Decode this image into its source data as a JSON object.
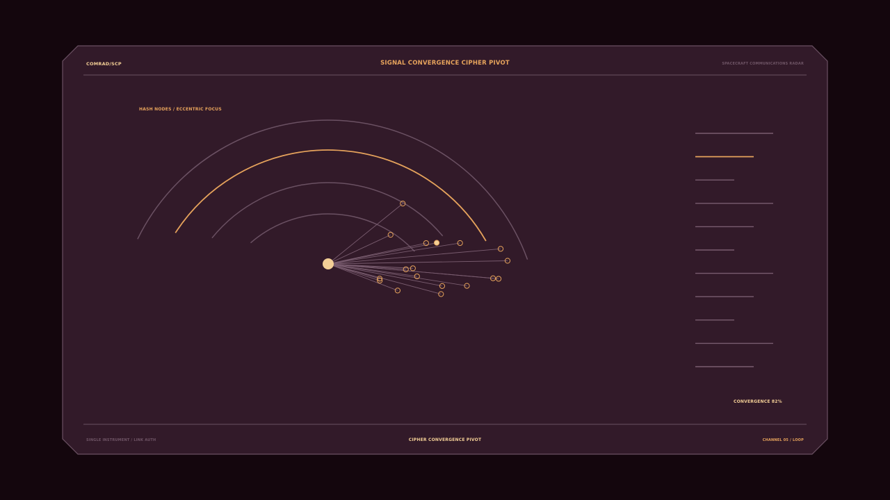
{
  "header": {
    "brand": "COMRAD/SCP",
    "title": "SIGNAL CONVERGENCE CIPHER PIVOT",
    "subtitle": "SPACECRAFT COMMUNICATIONS RADAR"
  },
  "panel": {
    "section_label": "HASH NODES / ECCENTRIC FOCUS",
    "convergence_label": "CONVERGENCE 82%"
  },
  "footer": {
    "left": "SINGLE INSTRUMENT / LINK AUTH",
    "center": "CIPHER CONVERGENCE PIVOT",
    "right": "CHANNEL 05 / LOOP"
  },
  "colors": {
    "background": "#14060d",
    "panel": "#321a29",
    "frame_line": "#6b5163",
    "accent": "#e6a35c",
    "accent_light": "#f3cf96",
    "muted": "#6f5566"
  },
  "indicator_bars": {
    "active_index": 1,
    "levels": [
      1.0,
      0.75,
      0.5,
      1.0,
      0.75,
      0.5,
      1.0,
      0.75,
      0.5,
      1.0,
      0.75
    ]
  },
  "nodes": [
    {
      "angle": -39,
      "distance": 138
    },
    {
      "angle": -25,
      "distance": 99
    },
    {
      "angle": -12,
      "distance": 144
    },
    {
      "angle": -11,
      "distance": 159
    },
    {
      "angle": -9,
      "distance": 192
    },
    {
      "angle": -5,
      "distance": 249
    },
    {
      "angle": -1,
      "distance": 258
    },
    {
      "angle": 3,
      "distance": 122
    },
    {
      "angle": 5,
      "distance": 238
    },
    {
      "angle": 8,
      "distance": 129
    },
    {
      "angle": 4,
      "distance": 112
    },
    {
      "angle": 5,
      "distance": 246
    },
    {
      "angle": 9,
      "distance": 202
    },
    {
      "angle": 11,
      "distance": 167
    },
    {
      "angle": 15,
      "distance": 168
    },
    {
      "angle": 18,
      "distance": 78
    },
    {
      "angle": 16,
      "distance": 77
    },
    {
      "angle": 21,
      "distance": 107
    }
  ],
  "highlighted_node_index": 3
}
